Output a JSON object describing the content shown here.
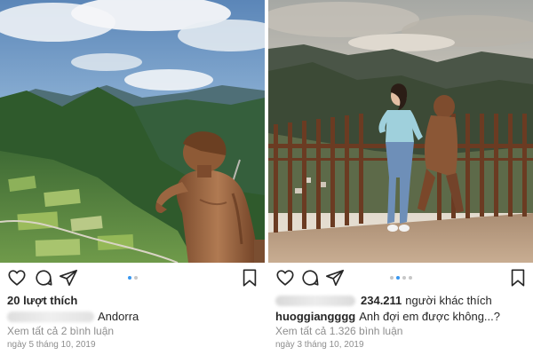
{
  "posts": [
    {
      "likes_text": "20 lượt thích",
      "caption_text": "Andorra",
      "comments_text": "Xem tất cả 2 bình luận",
      "date_text": "ngày 5 tháng 10, 2019",
      "carousel": {
        "count": 2,
        "active": 0
      }
    },
    {
      "likes_count": "234.211",
      "likes_suffix": "người khác thích",
      "username": "huoggiangggg",
      "caption_text": "Anh đợi em được không...?",
      "comments_text": "Xem tất cả 1.326 bình luận",
      "date_text": "ngày 3 tháng 10, 2019",
      "carousel": {
        "count": 4,
        "active": 1
      }
    }
  ],
  "icons": [
    "heart-icon",
    "comment-icon",
    "share-icon",
    "bookmark-icon"
  ],
  "colors": {
    "dot_active": "#3897f0",
    "dot_inactive": "#c7c7c7",
    "secondary_text": "#8e8e8e"
  }
}
